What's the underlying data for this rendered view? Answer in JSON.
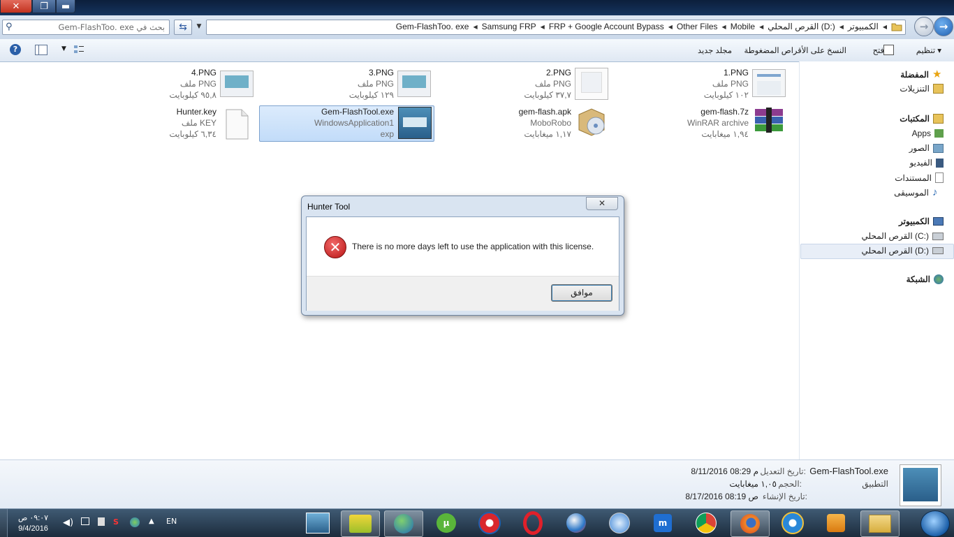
{
  "window": {
    "close": "✕",
    "maximize": "❐",
    "minimize": "▬"
  },
  "address": {
    "search_placeholder": "بحث في Gem-FlashToo. exe",
    "crumbs": [
      "الكمبيوتر",
      "القرص المحلي (D:)",
      "Mobile",
      "Other Files",
      "FRP + Google Account  Bypass",
      "Samsung FRP",
      "Gem-FlashToo. exe"
    ]
  },
  "toolbar": {
    "organize": "تنظيم ▾",
    "open": "فتح",
    "burn": "النسخ على الأقراص المضغوطة",
    "new_folder": "مجلد جديد"
  },
  "navpane": {
    "favorites": "المفضلة",
    "downloads": "التنزيلات",
    "libraries": "المكتبات",
    "apps": "Apps",
    "pictures": "الصور",
    "videos": "الفيديو",
    "documents": "المستندات",
    "music": "الموسيقى",
    "computer": "الكمبيوتر",
    "drive_c": "القرص المحلي (C:)",
    "drive_d": "القرص المحلي (D:)",
    "network": "الشبكة"
  },
  "files": [
    {
      "name": "1.PNG",
      "type": "ملف PNG",
      "size": "١٠٢ كيلوبايت"
    },
    {
      "name": "2.PNG",
      "type": "ملف PNG",
      "size": "٣٧,٧ كيلوبايت"
    },
    {
      "name": "3.PNG",
      "type": "ملف PNG",
      "size": "١٢٩ كيلوبايت"
    },
    {
      "name": "4.PNG",
      "type": "ملف PNG",
      "size": "٩٥,٨ كيلوبايت"
    },
    {
      "name": "gem-flash.7z",
      "type": "WinRAR archive",
      "size": "١,٩٤ ميغابايت"
    },
    {
      "name": "gem-flash.apk",
      "type": "MoboRobo",
      "size": "١,١٧ ميغابايت"
    },
    {
      "name": "Gem-FlashTool.exe",
      "type": "WindowsApplication1",
      "size": "exp"
    },
    {
      "name": "Hunter.key",
      "type": "ملف KEY",
      "size": "٦,٣٤ كيلوبايت"
    }
  ],
  "dialog": {
    "title": "Hunter Tool",
    "close": "✕",
    "message": "There is no more days left to use the application with this license.",
    "ok": "موافق"
  },
  "details": {
    "name": "Gem-FlashTool.exe",
    "kind": "التطبيق",
    "modified_label": "تاريخ التعديل:",
    "modified_value": "8/11/2016 08:29 م",
    "size_label": "الحجم:",
    "size_value": "١,٠٥ ميغابايت",
    "created_label": "تاريخ الإنشاء:",
    "created_value": "8/17/2016 08:19 ص"
  },
  "taskbar": {
    "time": "٠٩:٠٧ ص",
    "date": "9/4/2016",
    "lang": "EN"
  },
  "colors": {
    "accent": "#2a5fa8",
    "taskbar": "#1c2c3d",
    "error": "#c0191a"
  }
}
